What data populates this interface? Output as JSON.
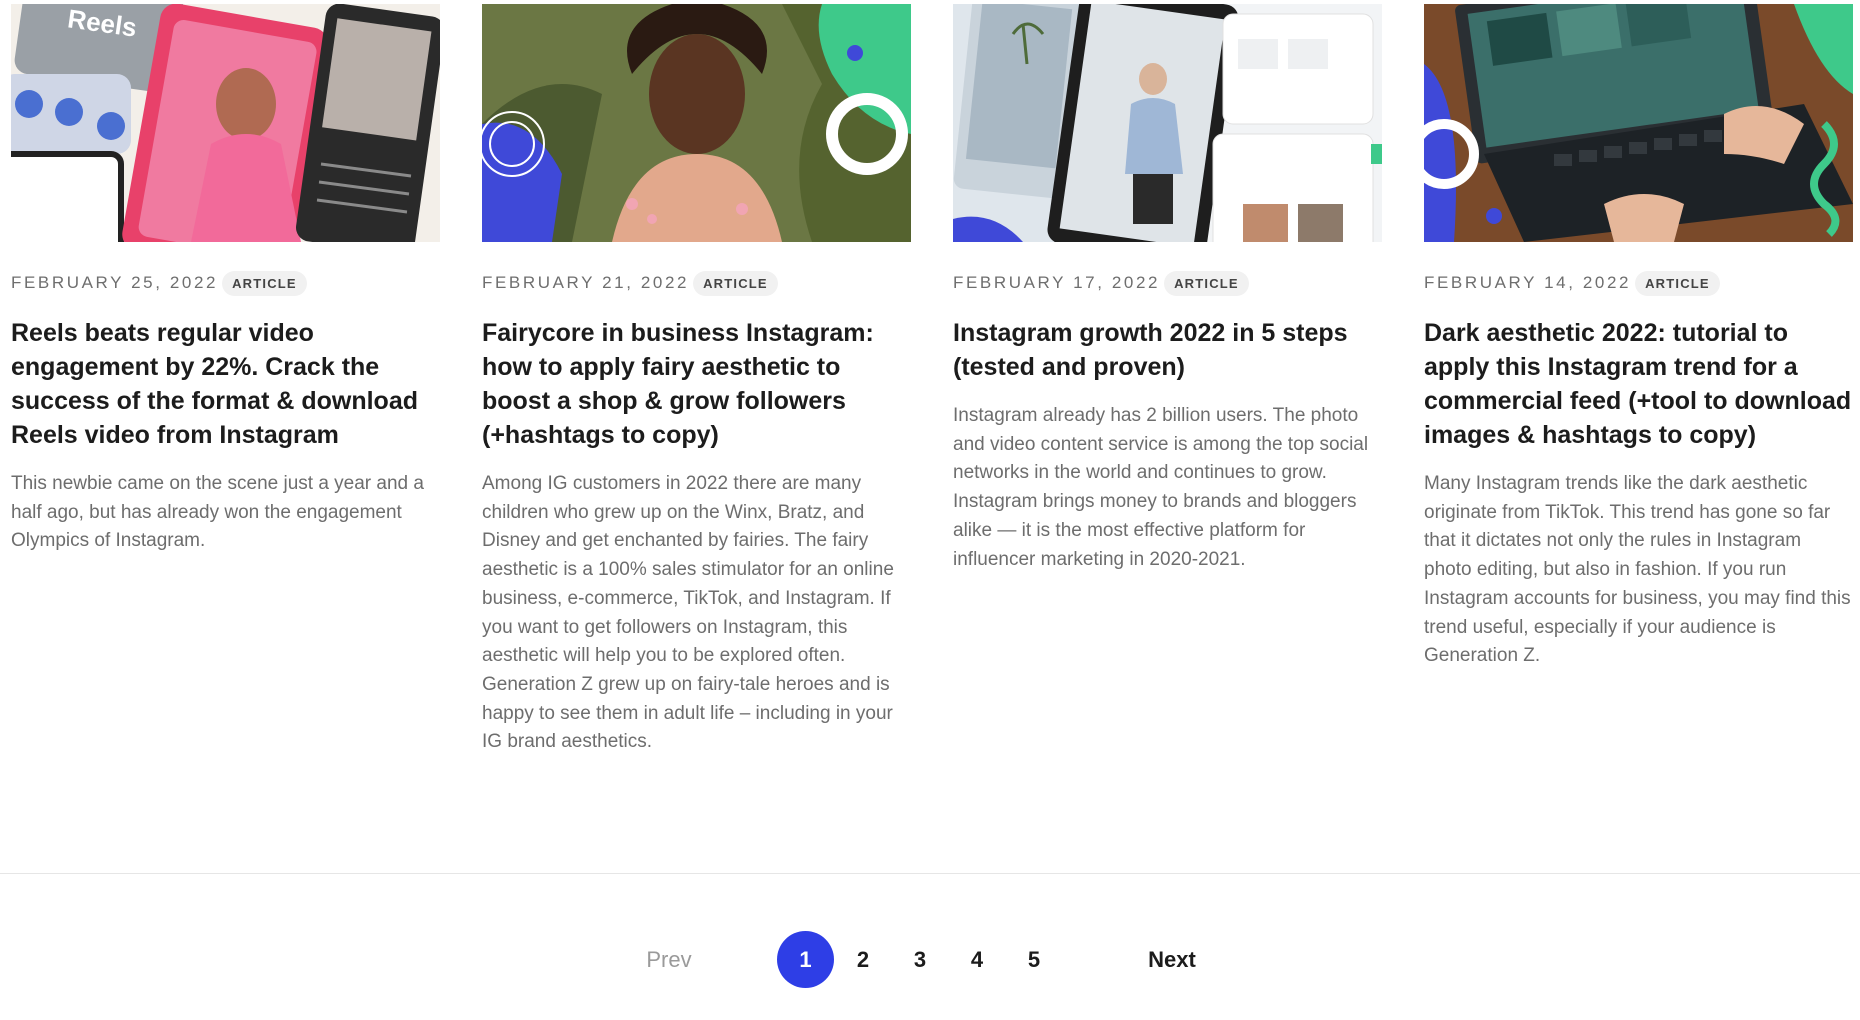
{
  "articles": [
    {
      "date": "FEBRUARY 25, 2022",
      "badge": "ARTICLE",
      "title": "Reels beats regular video engagement by 22%. Crack the success of the format & download Reels video from Instagram",
      "excerpt": "This newbie came on the scene just a year and a half ago, but has already won the engagement Olympics of Instagram.",
      "image_text": "Reels"
    },
    {
      "date": "FEBRUARY 21, 2022",
      "badge": "ARTICLE",
      "title": "Fairycore in business Instagram: how to apply fairy aesthetic to boost a shop & grow followers (+hashtags to copy)",
      "excerpt": "Among IG customers in 2022 there are many children who grew up on the Winx, Bratz, and Disney and get enchanted by fairies. The fairy aesthetic is a 100% sales stimulator for an online business, e-commerce, TikTok, and Instagram. If you want to get followers on Instagram, this aesthetic will help you to be explored often. Generation Z grew up on fairy-tale heroes and is happy to see them in adult life – including in your IG brand aesthetics."
    },
    {
      "date": "FEBRUARY 17, 2022",
      "badge": "ARTICLE",
      "title": "Instagram growth 2022 in 5 steps (tested and proven)",
      "excerpt": "Instagram already has 2 billion users. The photo and video content service is among the top social networks in the world and continues to grow. Instagram brings money to brands and bloggers alike — it is the most effective platform for influencer marketing in 2020-2021."
    },
    {
      "date": "FEBRUARY 14, 2022",
      "badge": "ARTICLE",
      "title": "Dark aesthetic 2022: tutorial to apply this Instagram trend for a commercial feed (+tool to download images & hashtags to copy)",
      "excerpt": "Many Instagram trends like the dark aesthetic originate from TikTok. This trend has gone so far that it dictates not only the rules in Instagram photo editing, but also in fashion. If you run Instagram accounts for business, you may find this trend useful, especially if your audience is Generation Z."
    }
  ],
  "pagination": {
    "prev": "Prev",
    "next": "Next",
    "pages": [
      "1",
      "2",
      "3",
      "4",
      "5"
    ],
    "current": "1"
  },
  "colors": {
    "accent_blue": "#2e3ee6",
    "accent_green": "#3ec98a",
    "title": "#1c1c1c",
    "excerpt": "#6d6d6d"
  }
}
